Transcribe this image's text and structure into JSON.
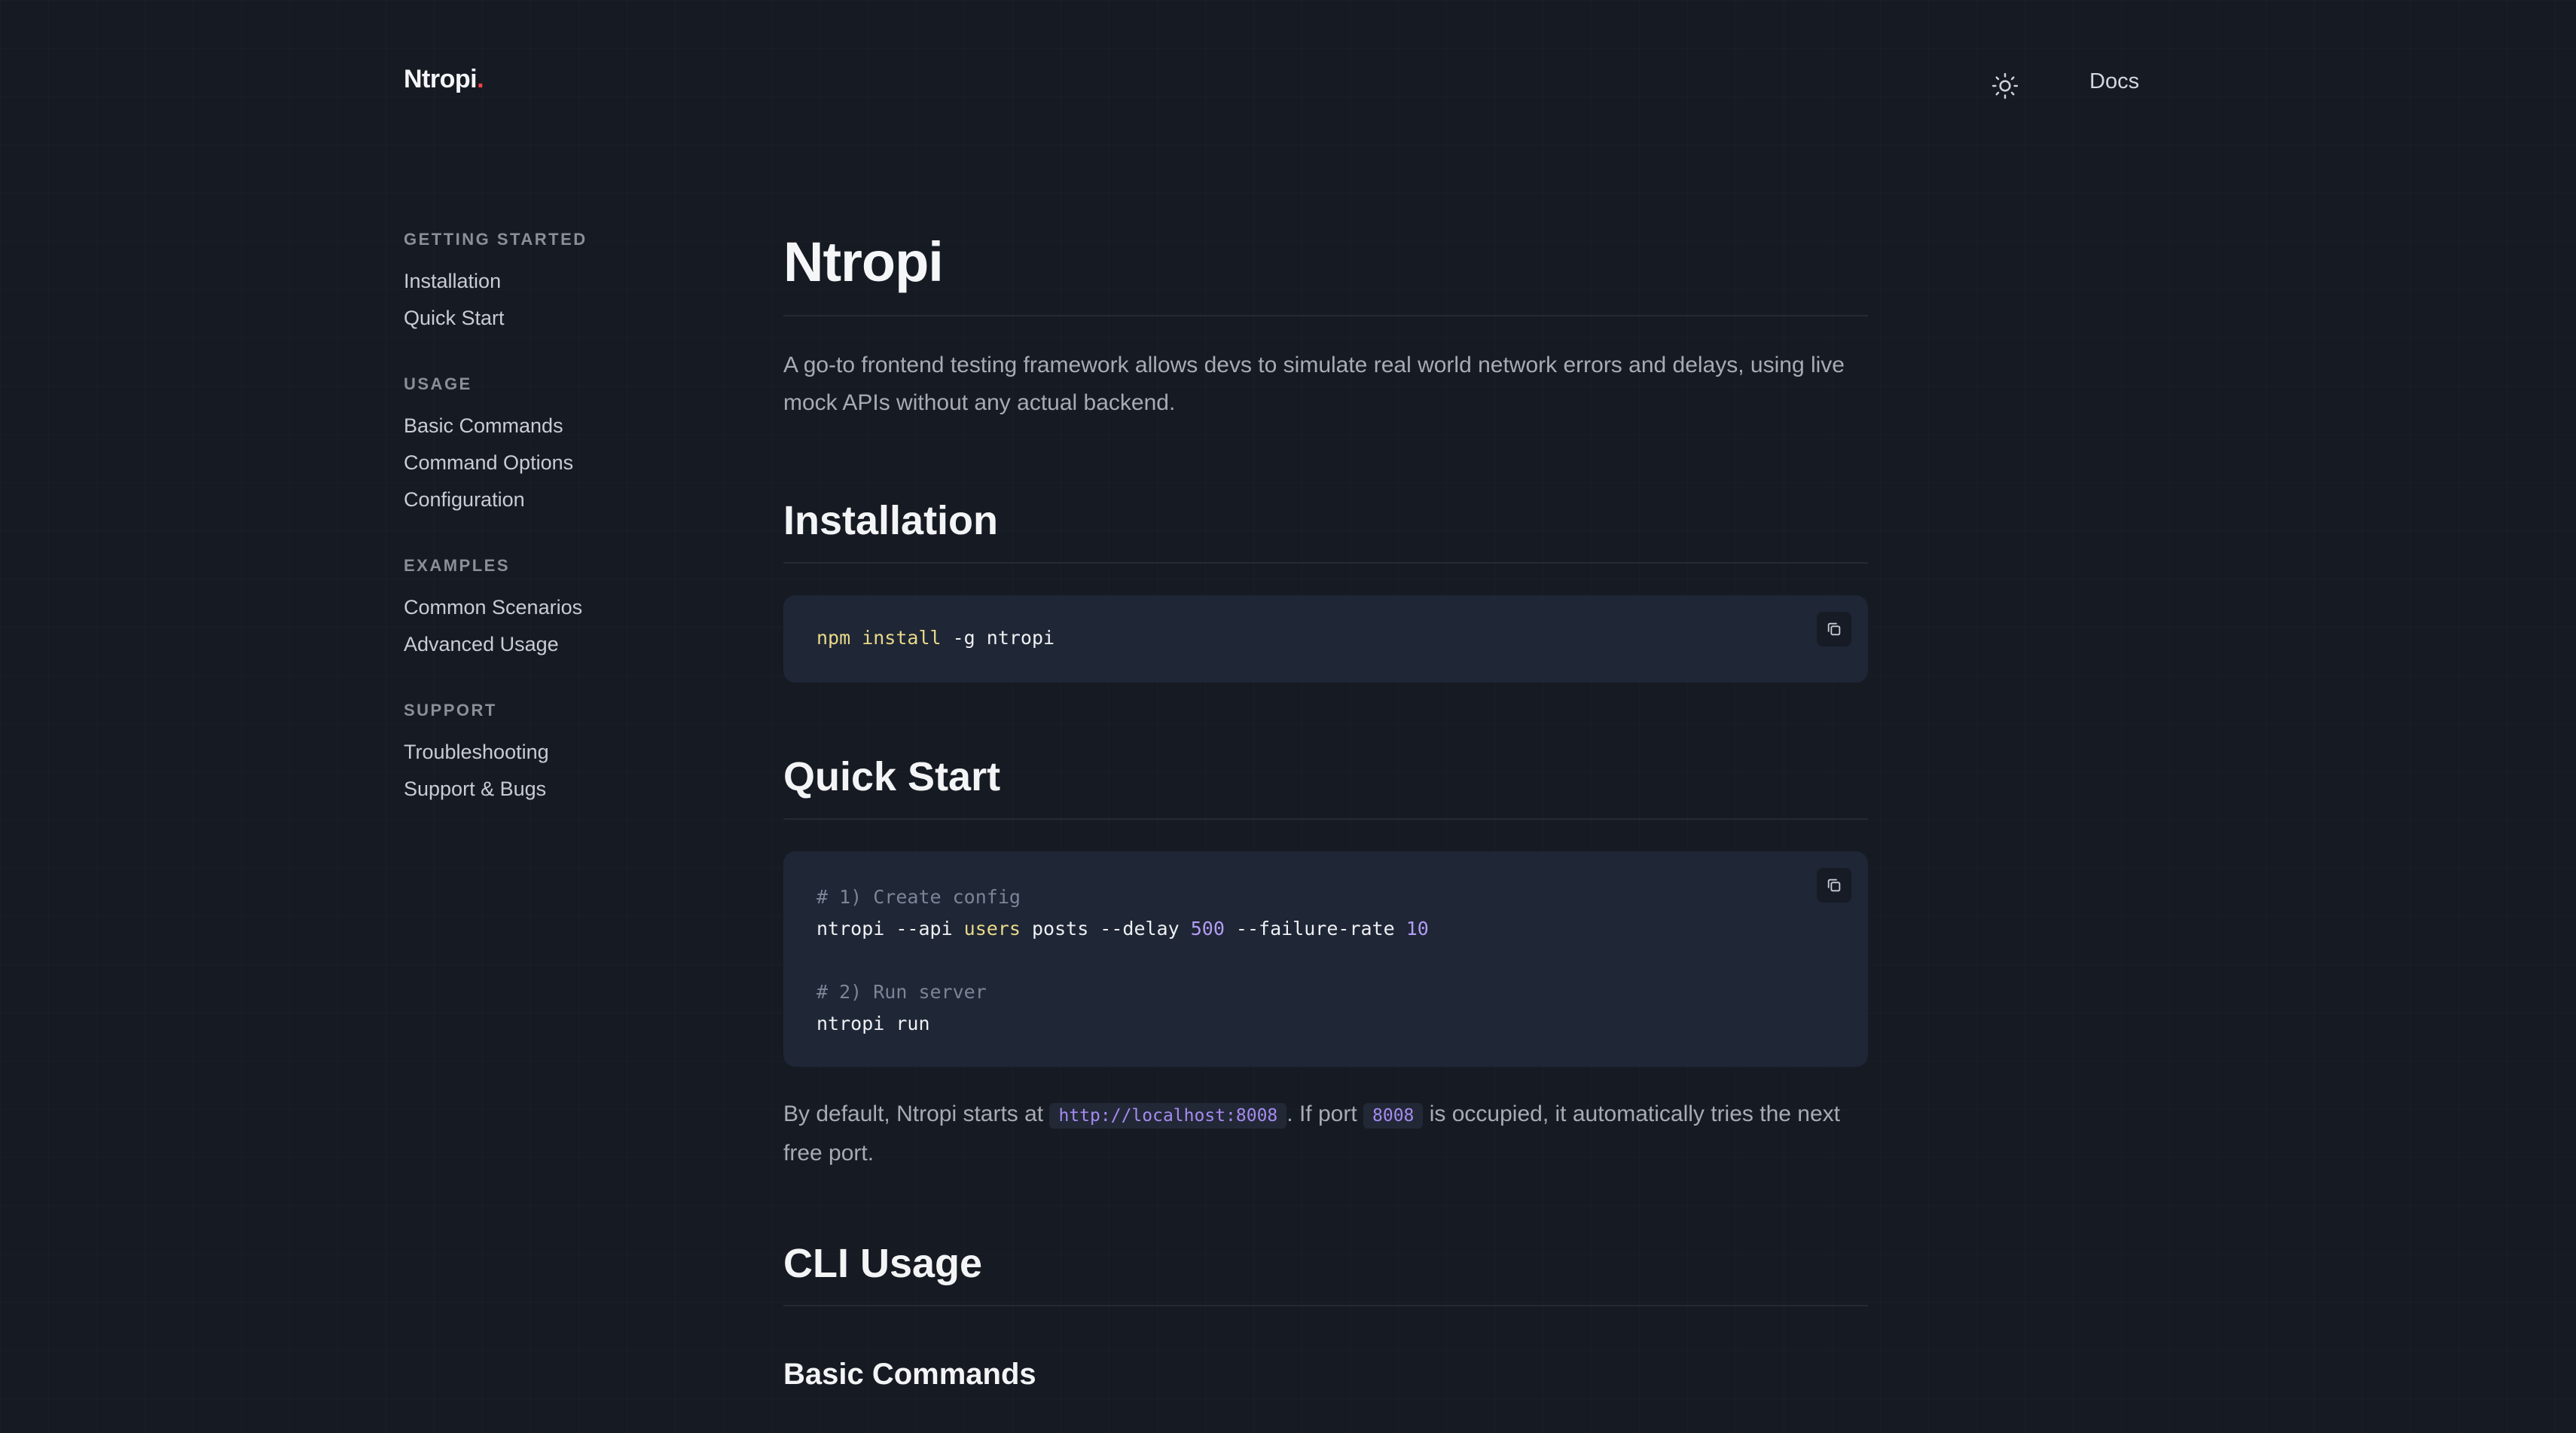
{
  "header": {
    "logo_text": "Ntropi",
    "logo_dot": ".",
    "theme_icon": "sun-icon",
    "nav_link": "Docs"
  },
  "sidebar": {
    "sections": [
      {
        "heading": "GETTING STARTED",
        "items": [
          "Installation",
          "Quick Start"
        ]
      },
      {
        "heading": "USAGE",
        "items": [
          "Basic Commands",
          "Command Options",
          "Configuration"
        ]
      },
      {
        "heading": "EXAMPLES",
        "items": [
          "Common Scenarios",
          "Advanced Usage"
        ]
      },
      {
        "heading": "SUPPORT",
        "items": [
          "Troubleshooting",
          "Support & Bugs"
        ]
      }
    ]
  },
  "main": {
    "title": "Ntropi",
    "intro": "A go-to frontend testing framework allows devs to simulate real world network errors and delays, using live mock APIs without any actual backend.",
    "installation": {
      "heading": "Installation",
      "code": {
        "cmd": "npm install",
        "rest": " -g ntropi"
      }
    },
    "quick_start": {
      "heading": "Quick Start",
      "code": {
        "comment1": "# 1) Create config",
        "line2_a": "ntropi --api ",
        "line2_kw": "users",
        "line2_b": " posts --delay ",
        "line2_n1": "500",
        "line2_c": " --failure-rate ",
        "line2_n2": "10",
        "comment2": "# 2) Run server",
        "line5": "ntropi run"
      },
      "note": {
        "p1": "By default, Ntropi starts at ",
        "code1": "http://localhost:8008",
        "p2": ". If port ",
        "code2": "8008",
        "p3": " is occupied, it automatically tries the next free port."
      }
    },
    "cli_usage": {
      "heading": "CLI Usage"
    },
    "basic_commands": {
      "heading": "Basic Commands"
    }
  },
  "colors": {
    "background": "#161a22",
    "code_bg": "#1f2635",
    "accent_red": "#ef4444",
    "keyword_yellow": "#e9d98a",
    "number_purple": "#b39cf5"
  },
  "icons": {
    "copy": "copy-icon"
  }
}
